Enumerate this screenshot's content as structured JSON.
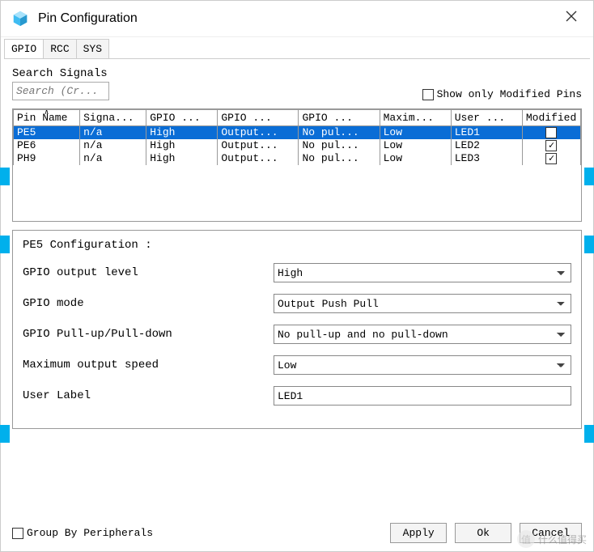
{
  "window": {
    "title": "Pin Configuration"
  },
  "tabs": [
    "GPIO",
    "RCC",
    "SYS"
  ],
  "active_tab": 0,
  "search": {
    "label": "Search Signals",
    "placeholder": "Search (Cr..."
  },
  "show_only": {
    "label": "Show only Modified Pins",
    "checked": false
  },
  "table": {
    "headers": [
      "Pin Name",
      "Signa...",
      "GPIO ...",
      "GPIO ...",
      "GPIO ...",
      "Maxim...",
      "User ...",
      "Modified"
    ],
    "rows": [
      {
        "cells": [
          "PE5",
          "n/a",
          "High",
          "Output...",
          "No pul...",
          "Low",
          "LED1"
        ],
        "modified": true,
        "selected": true
      },
      {
        "cells": [
          "PE6",
          "n/a",
          "High",
          "Output...",
          "No pul...",
          "Low",
          "LED2"
        ],
        "modified": true,
        "selected": false
      },
      {
        "cells": [
          "PH9",
          "n/a",
          "High",
          "Output...",
          "No pul...",
          "Low",
          "LED3"
        ],
        "modified": true,
        "selected": false
      }
    ]
  },
  "config": {
    "title": "PE5 Configuration :",
    "fields": [
      {
        "label": "GPIO output level",
        "type": "select",
        "value": "High"
      },
      {
        "label": "GPIO mode",
        "type": "select",
        "value": "Output Push Pull"
      },
      {
        "label": "GPIO Pull-up/Pull-down",
        "type": "select",
        "value": "No pull-up and no pull-down"
      },
      {
        "label": "Maximum output speed",
        "type": "select",
        "value": "Low"
      },
      {
        "label": "User Label",
        "type": "text",
        "value": "LED1"
      }
    ]
  },
  "footer": {
    "group_by": {
      "label": "Group By Peripherals",
      "checked": false
    },
    "buttons": {
      "apply": "Apply",
      "ok": "Ok",
      "cancel": "Cancel"
    }
  },
  "watermark": "什么值得买"
}
